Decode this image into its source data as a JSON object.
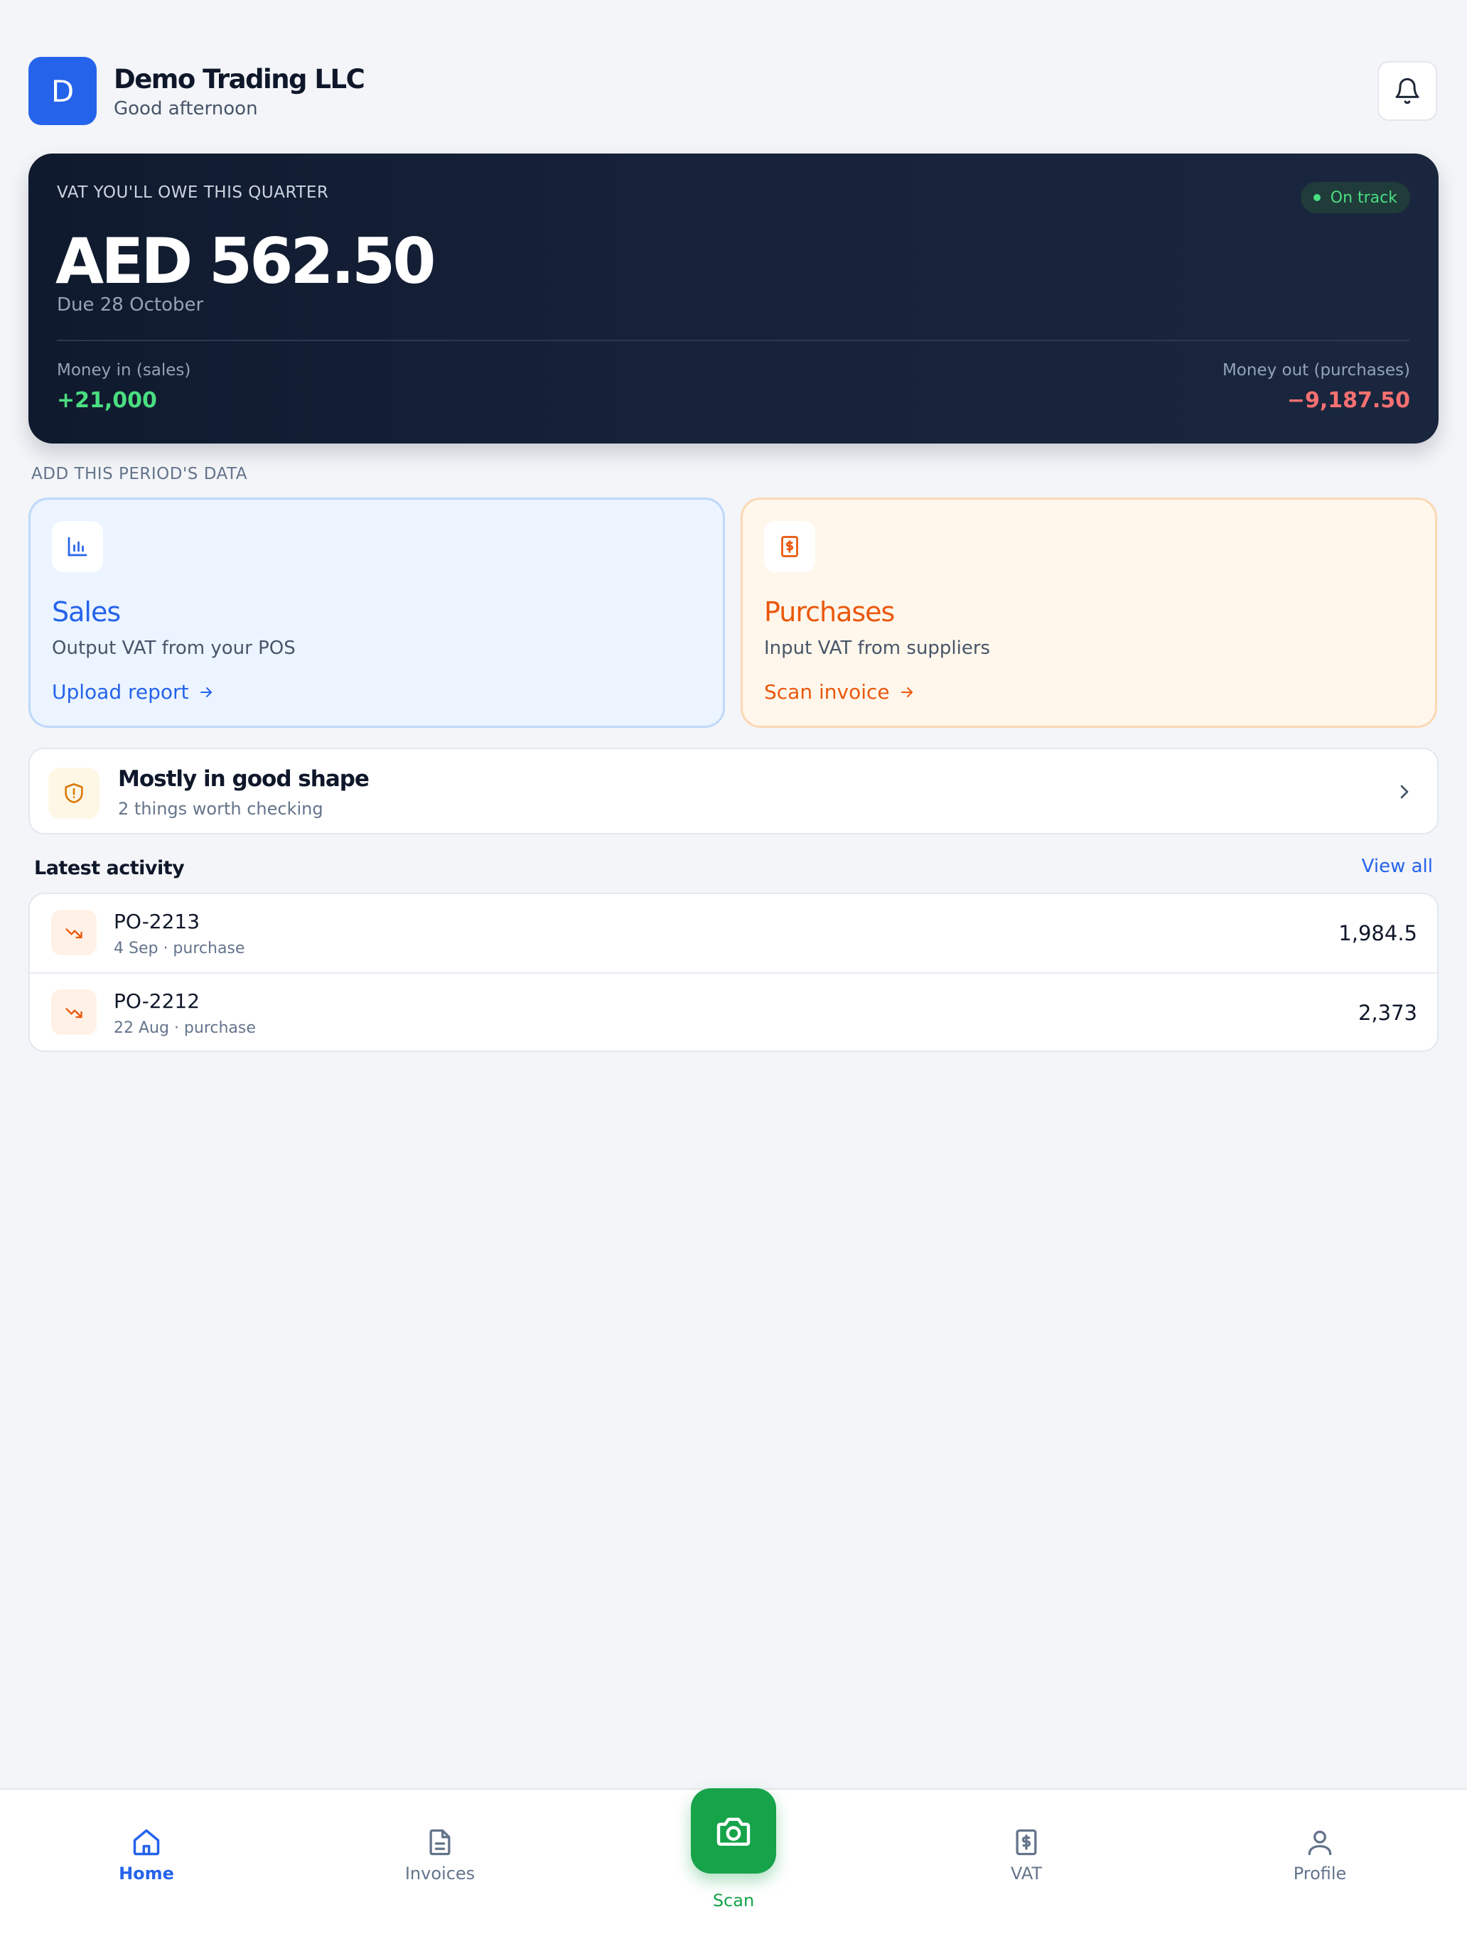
{
  "header": {
    "avatar_letter": "D",
    "company": "Demo Trading LLC",
    "greeting": "Good afternoon",
    "notifications_icon": "bell-icon"
  },
  "vat": {
    "label": "VAT YOU'LL OWE THIS QUARTER",
    "status": "On track",
    "amount": "AED 562.50",
    "due": "Due 28 October",
    "money_in_label": "Money in (sales)",
    "money_in_value": "+21,000",
    "money_out_label": "Money out (purchases)",
    "money_out_value": "−9,187.50"
  },
  "add_data": {
    "section_title": "ADD THIS PERIOD'S DATA",
    "sales": {
      "icon": "bar-chart-icon",
      "title": "Sales",
      "subtitle": "Output VAT from your POS",
      "action": "Upload report"
    },
    "purchases": {
      "icon": "receipt-icon",
      "title": "Purchases",
      "subtitle": "Input VAT from suppliers",
      "action": "Scan invoice"
    }
  },
  "health": {
    "icon": "shield-alert-icon",
    "title": "Mostly in good shape",
    "subtitle": "2 things worth checking"
  },
  "activity": {
    "title": "Latest activity",
    "view_all": "View all",
    "items": [
      {
        "id": "PO-2213",
        "meta": "4 Sep · purchase",
        "amount": "1,984.5"
      },
      {
        "id": "PO-2212",
        "meta": "22 Aug · purchase",
        "amount": "2,373"
      }
    ]
  },
  "nav": {
    "home": "Home",
    "invoices": "Invoices",
    "scan": "Scan",
    "vat": "VAT",
    "profile": "Profile"
  },
  "colors": {
    "primary": "#2563eb",
    "success": "#16a34a",
    "purchase_accent": "#ea580c",
    "card_dark": "#111a2e"
  }
}
